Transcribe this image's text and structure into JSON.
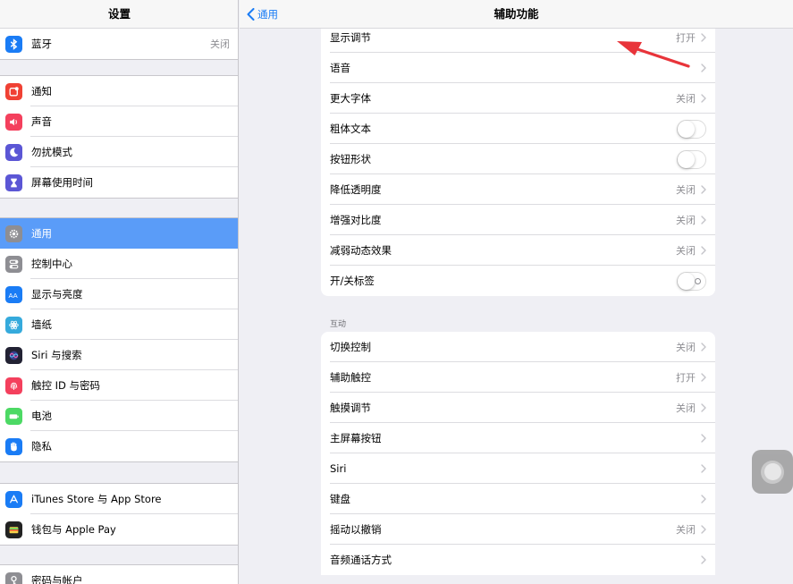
{
  "sidebar": {
    "title": "设置",
    "bluetooth": {
      "label": "蓝牙",
      "value": "关闭"
    },
    "items": [
      {
        "label": "通知",
        "icon": "notifications-icon",
        "color": "#f04134"
      },
      {
        "label": "声音",
        "icon": "sounds-icon",
        "color": "#f4405d"
      },
      {
        "label": "勿扰模式",
        "icon": "moon-icon",
        "color": "#5b56d5"
      },
      {
        "label": "屏幕使用时间",
        "icon": "hourglass-icon",
        "color": "#5b56d5"
      },
      {
        "label": "通用",
        "icon": "gear-icon",
        "color": "#8e8e93"
      },
      {
        "label": "控制中心",
        "icon": "control-center-icon",
        "color": "#8e8e93"
      },
      {
        "label": "显示与亮度",
        "icon": "display-brightness-icon",
        "color": "#1a7cf5"
      },
      {
        "label": "墙纸",
        "icon": "wallpaper-icon",
        "color": "#35aadc"
      },
      {
        "label": "Siri 与搜索",
        "icon": "siri-icon",
        "color": "#222233"
      },
      {
        "label": "触控 ID 与密码",
        "icon": "fingerprint-icon",
        "color": "#f4405d"
      },
      {
        "label": "电池",
        "icon": "battery-icon",
        "color": "#4cd964"
      },
      {
        "label": "隐私",
        "icon": "hand-icon",
        "color": "#1a7cf5"
      },
      {
        "label": "iTunes Store 与 App Store",
        "icon": "app-store-icon",
        "color": "#1a7cf5"
      },
      {
        "label": "钱包与 Apple Pay",
        "icon": "wallet-icon",
        "color": "#222222"
      },
      {
        "label": "密码与帐户",
        "icon": "key-icon",
        "color": "#8e8e93"
      }
    ],
    "selected_index": 4,
    "selected_color": "#5a9cf8"
  },
  "detail": {
    "back_label": "通用",
    "title": "辅助功能",
    "vision_rows": [
      {
        "label": "显示调节",
        "value": "打开",
        "control": "chevron"
      },
      {
        "label": "语音",
        "value": "",
        "control": "chevron"
      },
      {
        "label": "更大字体",
        "value": "关闭",
        "control": "chevron"
      },
      {
        "label": "粗体文本",
        "value": "",
        "control": "toggle-off"
      },
      {
        "label": "按钮形状",
        "value": "",
        "control": "toggle-off"
      },
      {
        "label": "降低透明度",
        "value": "关闭",
        "control": "chevron"
      },
      {
        "label": "增强对比度",
        "value": "关闭",
        "control": "chevron"
      },
      {
        "label": "减弱动态效果",
        "value": "关闭",
        "control": "chevron"
      },
      {
        "label": "开/关标签",
        "value": "",
        "control": "toggle-off-labeled"
      }
    ],
    "interaction_header": "互动",
    "interaction_rows": [
      {
        "label": "切换控制",
        "value": "关闭",
        "control": "chevron"
      },
      {
        "label": "辅助触控",
        "value": "打开",
        "control": "chevron"
      },
      {
        "label": "触摸调节",
        "value": "关闭",
        "control": "chevron"
      },
      {
        "label": "主屏幕按钮",
        "value": "",
        "control": "chevron"
      },
      {
        "label": "Siri",
        "value": "",
        "control": "chevron"
      },
      {
        "label": "键盘",
        "value": "",
        "control": "chevron"
      },
      {
        "label": "摇动以撤销",
        "value": "关闭",
        "control": "chevron"
      },
      {
        "label": "音频通话方式",
        "value": "",
        "control": "chevron"
      }
    ]
  },
  "colors": {
    "accent": "#1a7cf5",
    "annotation_arrow": "#e8343a",
    "background": "#efeff4"
  }
}
